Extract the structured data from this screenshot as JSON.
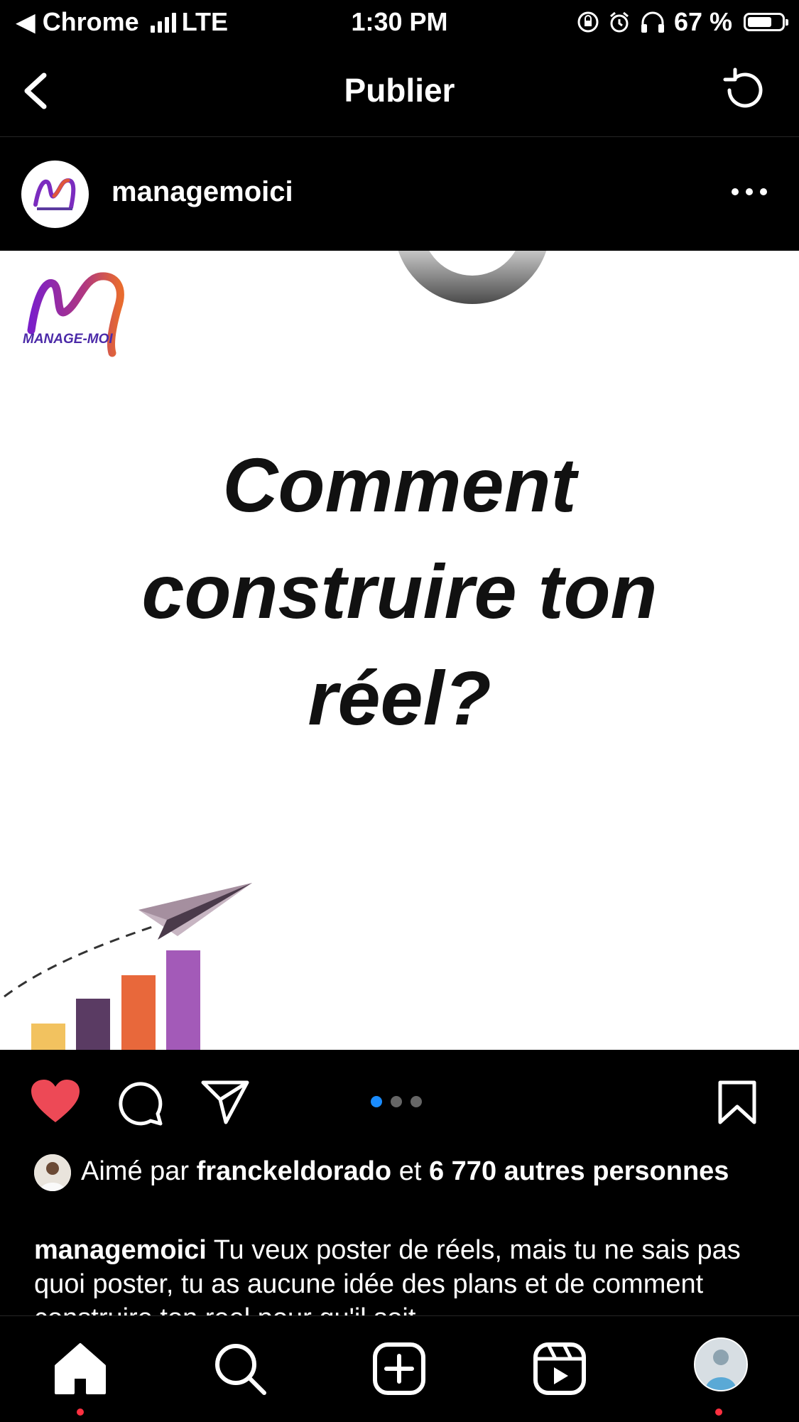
{
  "status_bar": {
    "back_app": "◀ Chrome",
    "network": "LTE",
    "time": "1:30 PM",
    "battery_text": "67 %",
    "battery_level": 0.67
  },
  "header": {
    "title": "Publier"
  },
  "post": {
    "username": "managemoici",
    "image": {
      "logo_text": "MANAGE-MOI",
      "headline_lines": [
        "Comment",
        "construire ton",
        "réel?"
      ],
      "bar_colors": [
        "#f2c25f",
        "#5a3b63",
        "#e8683b",
        "#a35ab8"
      ],
      "bar_levels": [
        0.27,
        0.52,
        0.76,
        1.0
      ]
    },
    "carousel": {
      "count": 3,
      "active": 1
    },
    "liked": true,
    "likes": {
      "prefix": "Aimé par",
      "user": "franckeldorado",
      "connector": "et",
      "others": "6 770 autres personnes"
    },
    "caption": {
      "user": "managemoici",
      "text": "Tu veux poster de réels, mais tu ne sais pas quoi poster, tu as aucune idée des plans et de comment construire ton reel pour qu'il soit"
    }
  },
  "colors": {
    "like_red": "#ed4956",
    "accent_blue": "#1a8cff",
    "notification_red": "#ff3040"
  },
  "tabs": [
    "home",
    "search",
    "create",
    "reels",
    "profile"
  ]
}
